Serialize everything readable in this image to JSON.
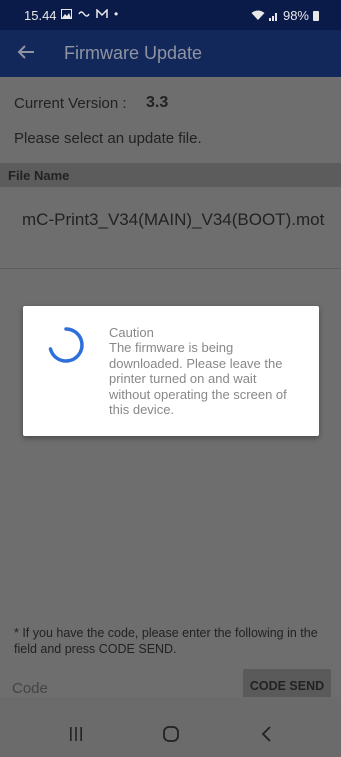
{
  "status_bar": {
    "time": "15.44",
    "battery": "98%"
  },
  "app_bar": {
    "title": "Firmware Update"
  },
  "version": {
    "label": "Current Version :",
    "value": "3.3"
  },
  "select_message": "Please select an update file.",
  "file_list": {
    "header": "File Name",
    "items": [
      "mC-Print3_V34(MAIN)_V34(BOOT).mot"
    ]
  },
  "code_section": {
    "note": "* If you have the code, please enter the following in the field and press CODE SEND.",
    "placeholder": "Code",
    "send_label": "CODE SEND"
  },
  "dialog": {
    "title": "Caution",
    "message": "The firmware is being downloaded. Please leave the printer turned on and wait without operating the screen of this device."
  },
  "colors": {
    "app_bar": "#12285a",
    "status_bar": "#0a1b4a",
    "spinner": "#2f6fdc"
  }
}
